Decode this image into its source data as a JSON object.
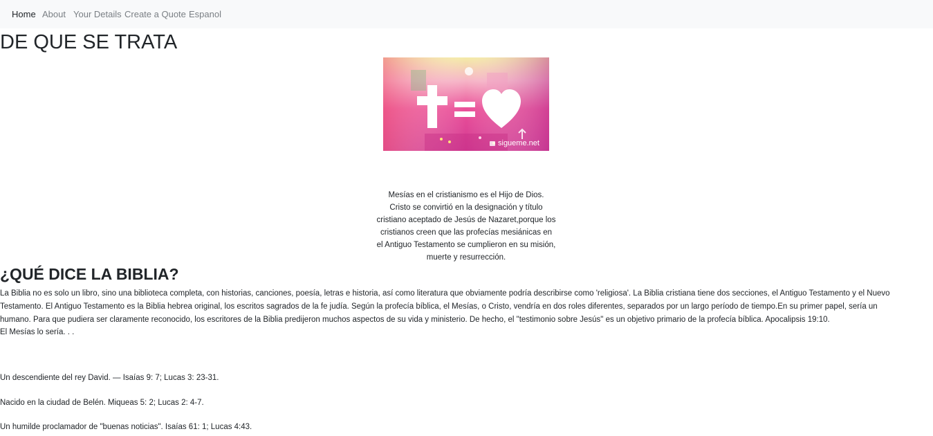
{
  "nav": {
    "items": [
      {
        "label": "Home"
      },
      {
        "label": "About"
      },
      {
        "label": "Your Details"
      },
      {
        "label": "Create a Quote"
      },
      {
        "label": "Espanol"
      }
    ]
  },
  "page_title": "DE QUE SE TRATA",
  "hero_image": {
    "watermark": "sigueme.net",
    "colors": {
      "pink": "#e8418f",
      "magenta": "#d63a9a",
      "yellow": "#f2e59a"
    }
  },
  "intro": {
    "lines": [
      "Mesías en el cristianismo es el Hijo de Dios.",
      "Cristo se convirtió en la designación y título",
      "cristiano aceptado de Jesús de Nazaret,porque los",
      "cristianos creen que las profecías mesiánicas en",
      "el Antiguo Testamento se cumplieron en su misión,",
      "muerte y resurrección."
    ]
  },
  "section": {
    "heading": "¿QUÉ DICE LA BIBLIA?",
    "paragraph_lines": [
      "La Biblia no es solo un libro, sino una biblioteca completa, con historias, canciones, poesía, letras e historia, así como literatura que obviamente podría describirse como 'religiosa'. La Biblia cristiana tiene dos secciones, el Antiguo Testamento y el Nuevo",
      "Testamento. El Antiguo Testamento es la Biblia hebrea original, los escritos sagrados de la fe judía. Según la profecía bíblica, el Mesías, o Cristo, vendría en dos roles diferentes, separados por un largo período de tiempo.En su primer papel, sería un",
      "humano. Para que pudiera ser claramente reconocido, los escritores de la Biblia predijeron muchos aspectos de su vida y ministerio. De hecho, el \"testimonio sobre Jesús\" es un objetivo primario de la profecía bíblica. Apocalipsis 19:10.",
      "El Mesías lo sería. . ."
    ],
    "prophecies": [
      "Un descendiente del rey David. — Isaías 9: 7; Lucas 3: 23-31.",
      "Nacido en la ciudad de Belén. Miqueas 5: 2; Lucas 2: 4-7.",
      "Un humilde proclamador de \"buenas noticias\". Isaías 61: 1; Lucas 4:43."
    ]
  }
}
